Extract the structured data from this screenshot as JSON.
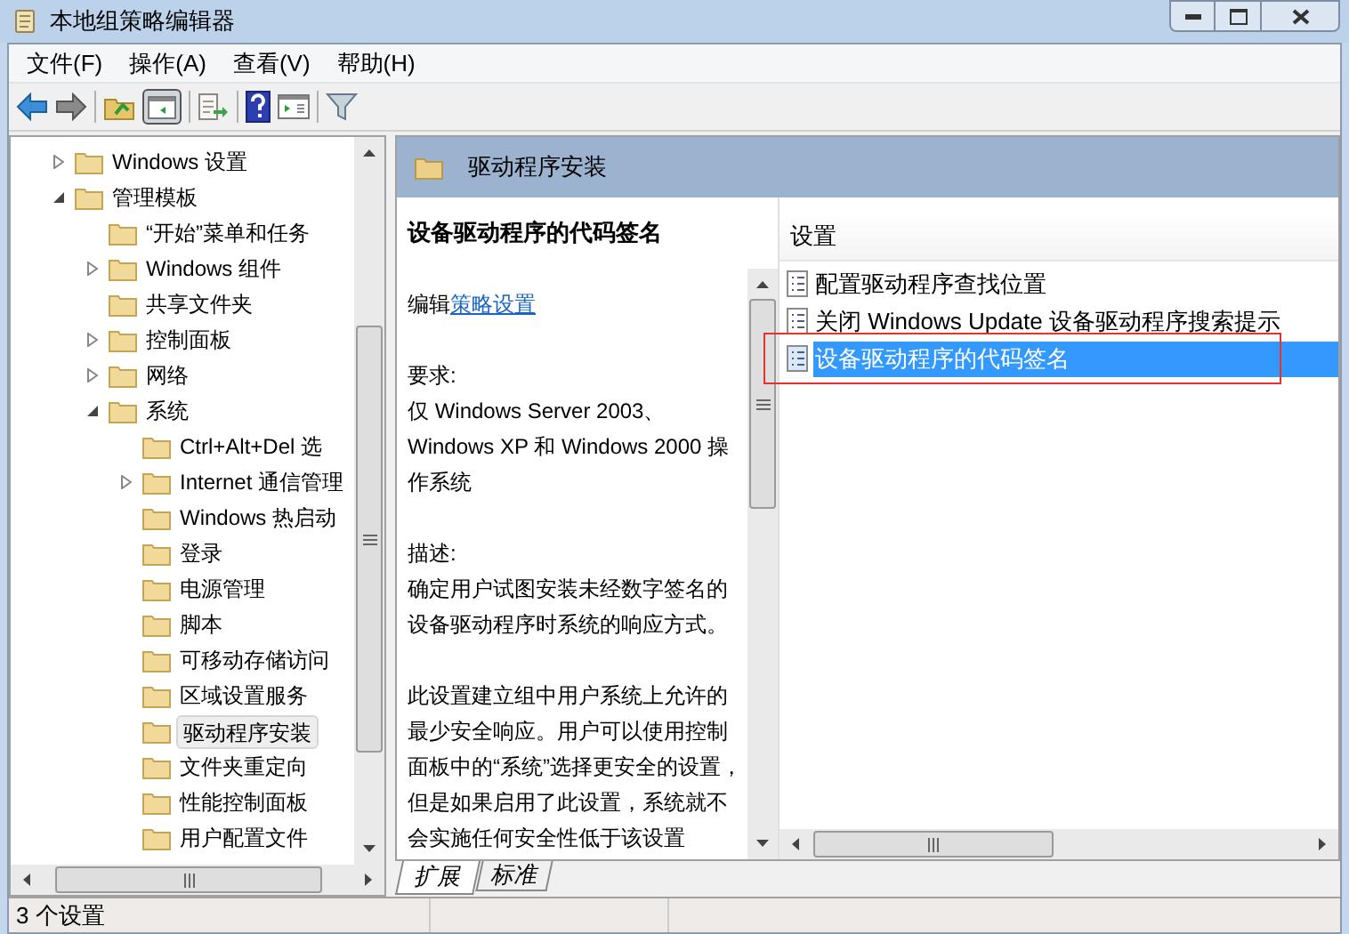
{
  "window": {
    "title": "本地组策略编辑器"
  },
  "menu": [
    "文件(F)",
    "操作(A)",
    "查看(V)",
    "帮助(H)"
  ],
  "tree": [
    {
      "label": "Windows 设置",
      "expanded": false,
      "selected": false
    },
    {
      "label": "管理模板",
      "expanded": true,
      "selected": false,
      "children": [
        {
          "label": "“开始”菜单和任务",
          "selected": false
        },
        {
          "label": "Windows 组件",
          "expanded": false,
          "selected": false
        },
        {
          "label": "共享文件夹",
          "selected": false
        },
        {
          "label": "控制面板",
          "expanded": false,
          "selected": false
        },
        {
          "label": "网络",
          "expanded": false,
          "selected": false
        },
        {
          "label": "系统",
          "expanded": true,
          "selected": false,
          "children": [
            {
              "label": "Ctrl+Alt+Del 选",
              "selected": false
            },
            {
              "label": "Internet 通信管理",
              "expanded": false,
              "selected": false
            },
            {
              "label": "Windows 热启动",
              "selected": false
            },
            {
              "label": "登录",
              "selected": false
            },
            {
              "label": "电源管理",
              "selected": false
            },
            {
              "label": "脚本",
              "selected": false
            },
            {
              "label": "可移动存储访问",
              "selected": false
            },
            {
              "label": "区域设置服务",
              "selected": false
            },
            {
              "label": "驱动程序安装",
              "selected": true
            },
            {
              "label": "文件夹重定向",
              "selected": false
            },
            {
              "label": "性能控制面板",
              "selected": false
            },
            {
              "label": "用户配置文件",
              "selected": false
            }
          ]
        }
      ]
    }
  ],
  "details": {
    "header": "驱动程序安装",
    "title": "设备驱动程序的代码签名",
    "edit_prefix": "编辑",
    "edit_link": "策略设置",
    "paragraphs": [
      "要求:\n仅 Windows Server 2003、Windows XP 和 Windows 2000 操作系统",
      "描述:\n确定用户试图安装未经数字签名的设备驱动程序时系统的响应方式。",
      "此设置建立组中用户系统上允许的最少安全响应。用户可以使用控制面板中的“系统”选择更安全的设置，但是如果启用了此设置，系统就不会实施任何安全性低于该设置"
    ]
  },
  "settings": {
    "column": "设置",
    "rows": [
      {
        "label": "配置驱动程序查找位置",
        "selected": false
      },
      {
        "label": "关闭 Windows Update 设备驱动程序搜索提示",
        "selected": false
      },
      {
        "label": "设备驱动程序的代码签名",
        "selected": true
      }
    ]
  },
  "tabs": [
    {
      "label": "扩展",
      "selected": true
    },
    {
      "label": "标准",
      "selected": false
    }
  ],
  "status_bar": "3 个设置"
}
